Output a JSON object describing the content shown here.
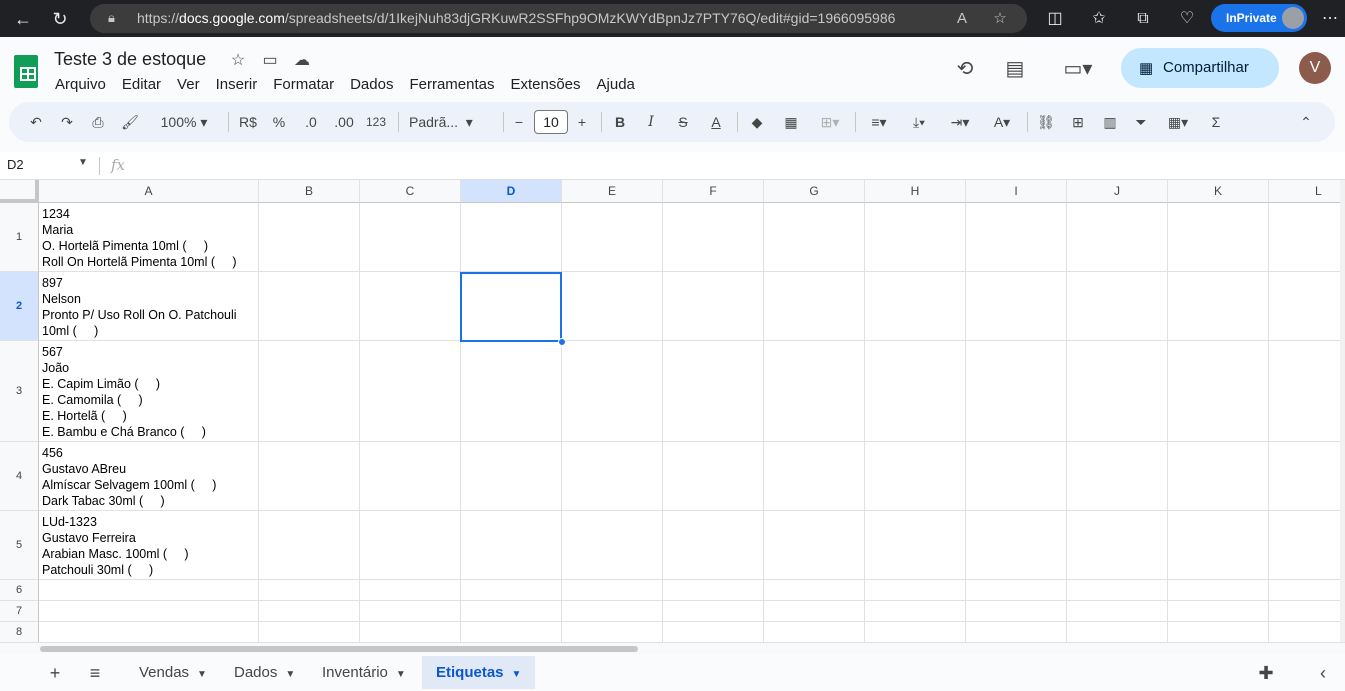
{
  "browser": {
    "url_prefix": "https://",
    "url_host": "docs.google.com",
    "url_path": "/spreadsheets/d/1IkejNuh83djGRKuwR2SSFhp9OMzKWYdBpnJz7PTY76Q/edit#gid=1966095986",
    "inprivate_label": "InPrivate"
  },
  "doc": {
    "title": "Teste 3 de estoque",
    "menu": [
      "Arquivo",
      "Editar",
      "Ver",
      "Inserir",
      "Formatar",
      "Dados",
      "Ferramentas",
      "Extensões",
      "Ajuda"
    ],
    "share_label": "Compartilhar",
    "avatar_letter": "V"
  },
  "toolbar": {
    "zoom": "100%",
    "currency": "R$",
    "percent": "%",
    "dec_decrease": ".0",
    "dec_increase": ".00",
    "number_format": "123",
    "font": "Padrã...",
    "font_size": "10"
  },
  "formula": {
    "cell_ref": "D2",
    "fx": "fx"
  },
  "grid": {
    "columns": [
      "A",
      "B",
      "C",
      "D",
      "E",
      "F",
      "G",
      "H",
      "I",
      "J",
      "K",
      "L"
    ],
    "selected_column": "D",
    "rows": [
      "1",
      "2",
      "3",
      "4",
      "5",
      "6",
      "7",
      "8"
    ],
    "selected_row": "2",
    "cells_a": [
      "1234\nMaria\nO. Hortelã Pimenta 10ml (     )\nRoll On Hortelã Pimenta 10ml (     )",
      "897\nNelson\nPronto P/ Uso Roll On O. Patchouli\n10ml (     )",
      "567\nJoão\nE. Capim Limão (     )\nE. Camomila (     )\nE. Hortelã (     )\nE. Bambu e Chá Branco (     )",
      "456\nGustavo ABreu\nAlmíscar Selvagem 100ml (     )\nDark Tabac 30ml (     )",
      "LUd-1323\nGustavo Ferreira\nArabian Masc. 100ml (     )\nPatchouli 30ml (     )"
    ]
  },
  "sheets": {
    "tabs": [
      "Vendas",
      "Dados",
      "Inventário",
      "Etiquetas"
    ],
    "active": "Etiquetas"
  }
}
